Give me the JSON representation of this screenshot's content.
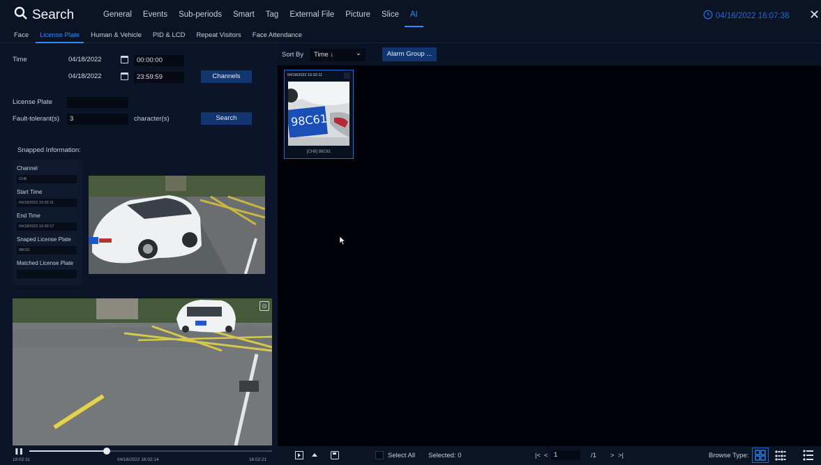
{
  "header": {
    "title": "Search",
    "tabs": [
      "General",
      "Events",
      "Sub-periods",
      "Smart",
      "Tag",
      "External File",
      "Picture",
      "Slice",
      "AI"
    ],
    "active_tab": "AI",
    "clock": "04/16/2022 16:07:38",
    "close_icon": "close-icon"
  },
  "subtabs": {
    "items": [
      "Face",
      "License Plate",
      "Human & Vehicle",
      "PID & LCD",
      "Repeat Visitors",
      "Face Attendance"
    ],
    "active": "License Plate"
  },
  "filters": {
    "time_label": "Time",
    "start_date": "04/18/2022",
    "start_time": "00:00:00",
    "end_date": "04/18/2022",
    "end_time": "23:59:59",
    "channels_button": "Channels",
    "plate_label": "License Plate",
    "plate_value": "",
    "fault_label": "Fault-tolerant(s)",
    "fault_value": "3",
    "fault_unit": "character(s)",
    "search_button": "Search"
  },
  "snapped": {
    "heading": "Snapped Information:",
    "channel_label": "Channel",
    "channel_value": "CH8",
    "start_label": "Start Time",
    "start_value": "04/18/2022 16:02:11",
    "end_label": "End Time",
    "end_value": "04/18/2022 16:02:17",
    "plate_label": "Snaped License Plate",
    "plate_value": "98C61",
    "matched_label": "Matched License Plate",
    "matched_value": ""
  },
  "playback": {
    "play_icon": "pause-icon",
    "start": "16:02:11",
    "current": "04/18/2022 16:02:14",
    "end": "16:02:21",
    "progress_fraction": 0.32
  },
  "sortbar": {
    "sort_label": "Sort By",
    "sort_value": "Time ↓",
    "alarm_button": "Alarm Group ..."
  },
  "results": [
    {
      "time": "04/18/2022 16:02:11",
      "plate_image_text": "98C61",
      "caption": "[CH8] 98C61"
    }
  ],
  "footer": {
    "select_all": "Select All",
    "selected": "Selected: 0",
    "page_first": "|<",
    "page_prev": "<",
    "page_current": "1",
    "page_total": "/1",
    "page_next": ">",
    "page_last": ">|",
    "browse_type": "Browse Type:"
  }
}
